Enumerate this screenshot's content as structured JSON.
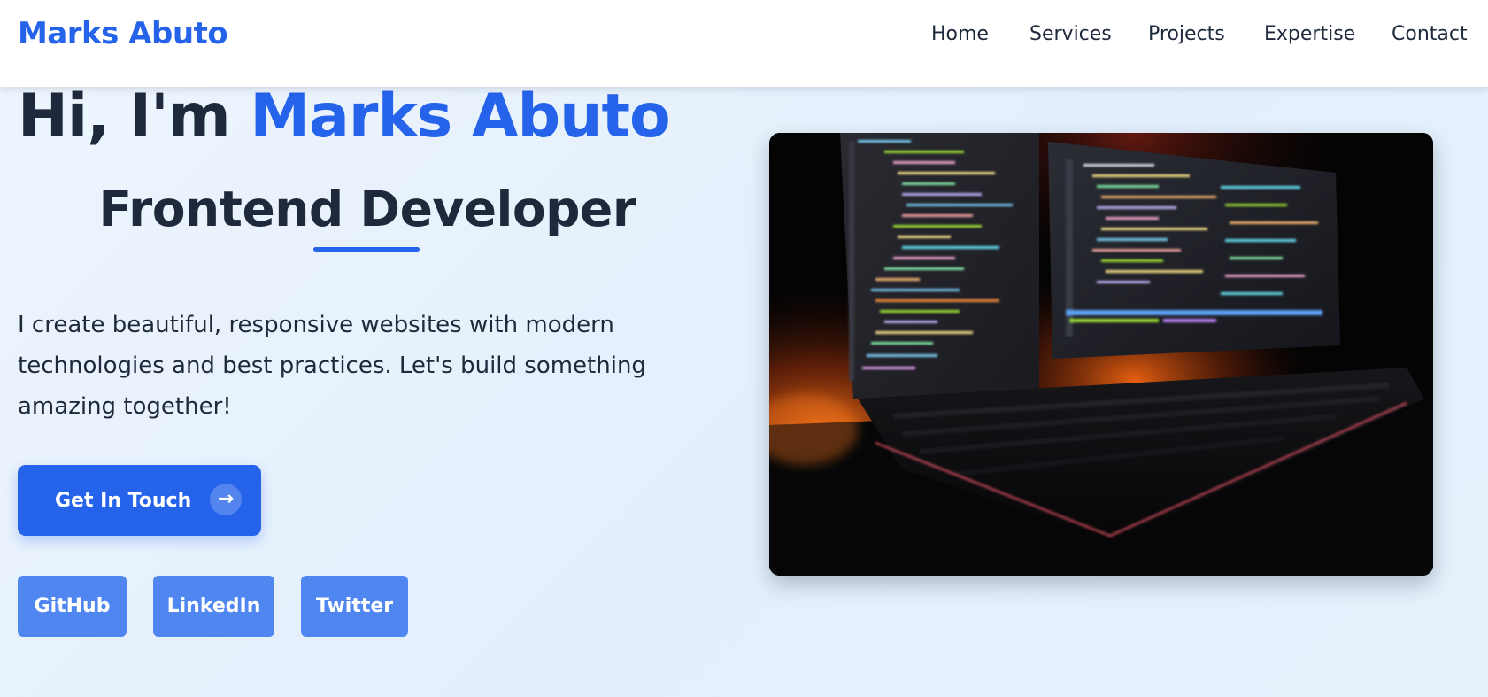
{
  "header": {
    "brand": "Marks Abuto",
    "nav": {
      "home": "Home",
      "services": "Services",
      "projects": "Projects",
      "expertise": "Expertise",
      "contact": "Contact"
    }
  },
  "hero": {
    "greeting": "Hi, I'm ",
    "name": "Marks Abuto",
    "role": "Frontend Developer",
    "description": "I create beautiful, responsive websites with modern technologies and best practices. Let's build something amazing together!",
    "cta": {
      "label": "Get In Touch",
      "icon": "arrow-right-icon",
      "glyph": "→"
    },
    "socials": {
      "github": "GitHub",
      "linkedin": "LinkedIn",
      "twitter": "Twitter"
    }
  },
  "image": {
    "subject": "dual-monitor-code-setup-with-keyboard"
  },
  "colors": {
    "accent": "#2563eb",
    "social_button": "#4f86f0",
    "text": "#1e293b",
    "background": "#e6f1fc"
  }
}
